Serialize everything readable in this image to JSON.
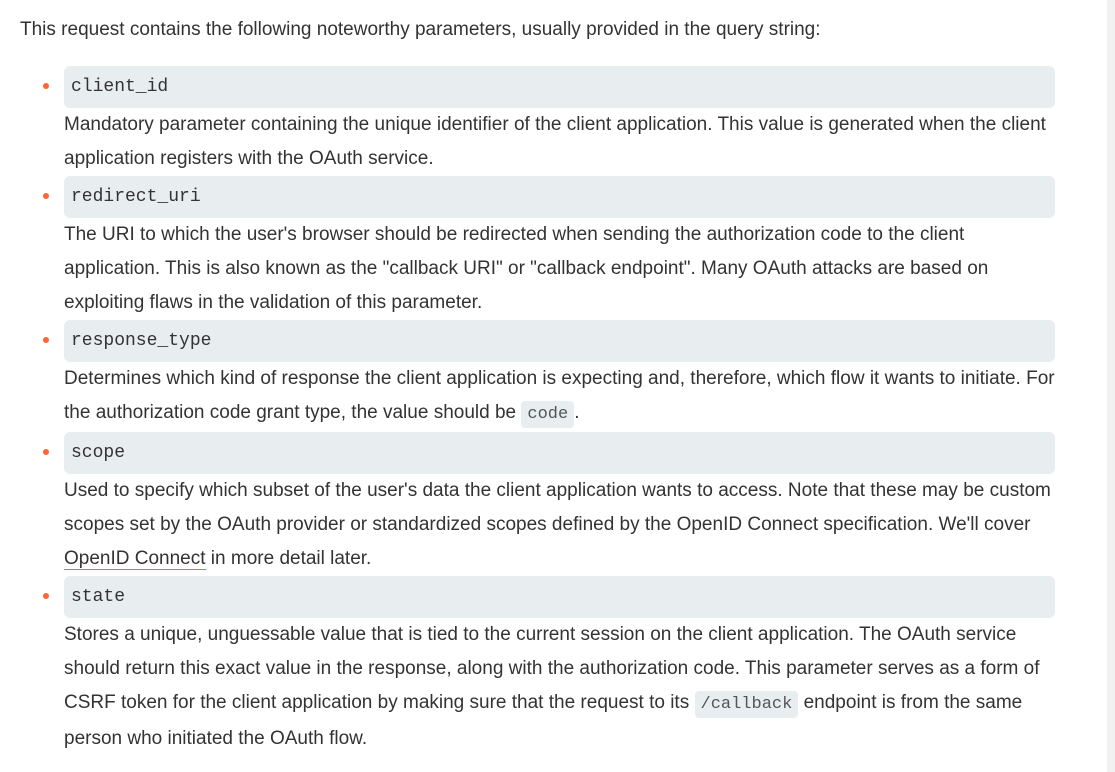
{
  "intro": "This request contains the following noteworthy parameters, usually provided in the query string:",
  "params": [
    {
      "name": "client_id",
      "desc": "Mandatory parameter containing the unique identifier of the client application. This value is generated when the client application registers with the OAuth service."
    },
    {
      "name": "redirect_uri",
      "desc": "The URI to which the user's browser should be redirected when sending the authorization code to the client application. This is also known as the \"callback URI\" or \"callback endpoint\". Many OAuth attacks are based on exploiting flaws in the validation of this parameter."
    },
    {
      "name": "response_type",
      "desc_before": "Determines which kind of response the client application is expecting and, therefore, which flow it wants to initiate. For the authorization code grant type, the value should be ",
      "desc_code": "code",
      "desc_after": "."
    },
    {
      "name": "scope",
      "desc_before": "Used to specify which subset of the user's data the client application wants to access. Note that these may be custom scopes set by the OAuth provider or standardized scopes defined by the OpenID Connect specification. We'll cover ",
      "desc_link": "OpenID Connect",
      "desc_after": " in more detail later."
    },
    {
      "name": "state",
      "desc_before": "Stores a unique, unguessable value that is tied to the current session on the client application. The OAuth service should return this exact value in the response, along with the authorization code. This parameter serves as a form of CSRF token for the client application by making sure that the request to its ",
      "desc_code": "/callback",
      "desc_after": " endpoint is from the same person who initiated the OAuth flow."
    }
  ],
  "colors": {
    "bullet": "#ff6633",
    "code_bg": "#e8edf0",
    "text": "#333333"
  }
}
